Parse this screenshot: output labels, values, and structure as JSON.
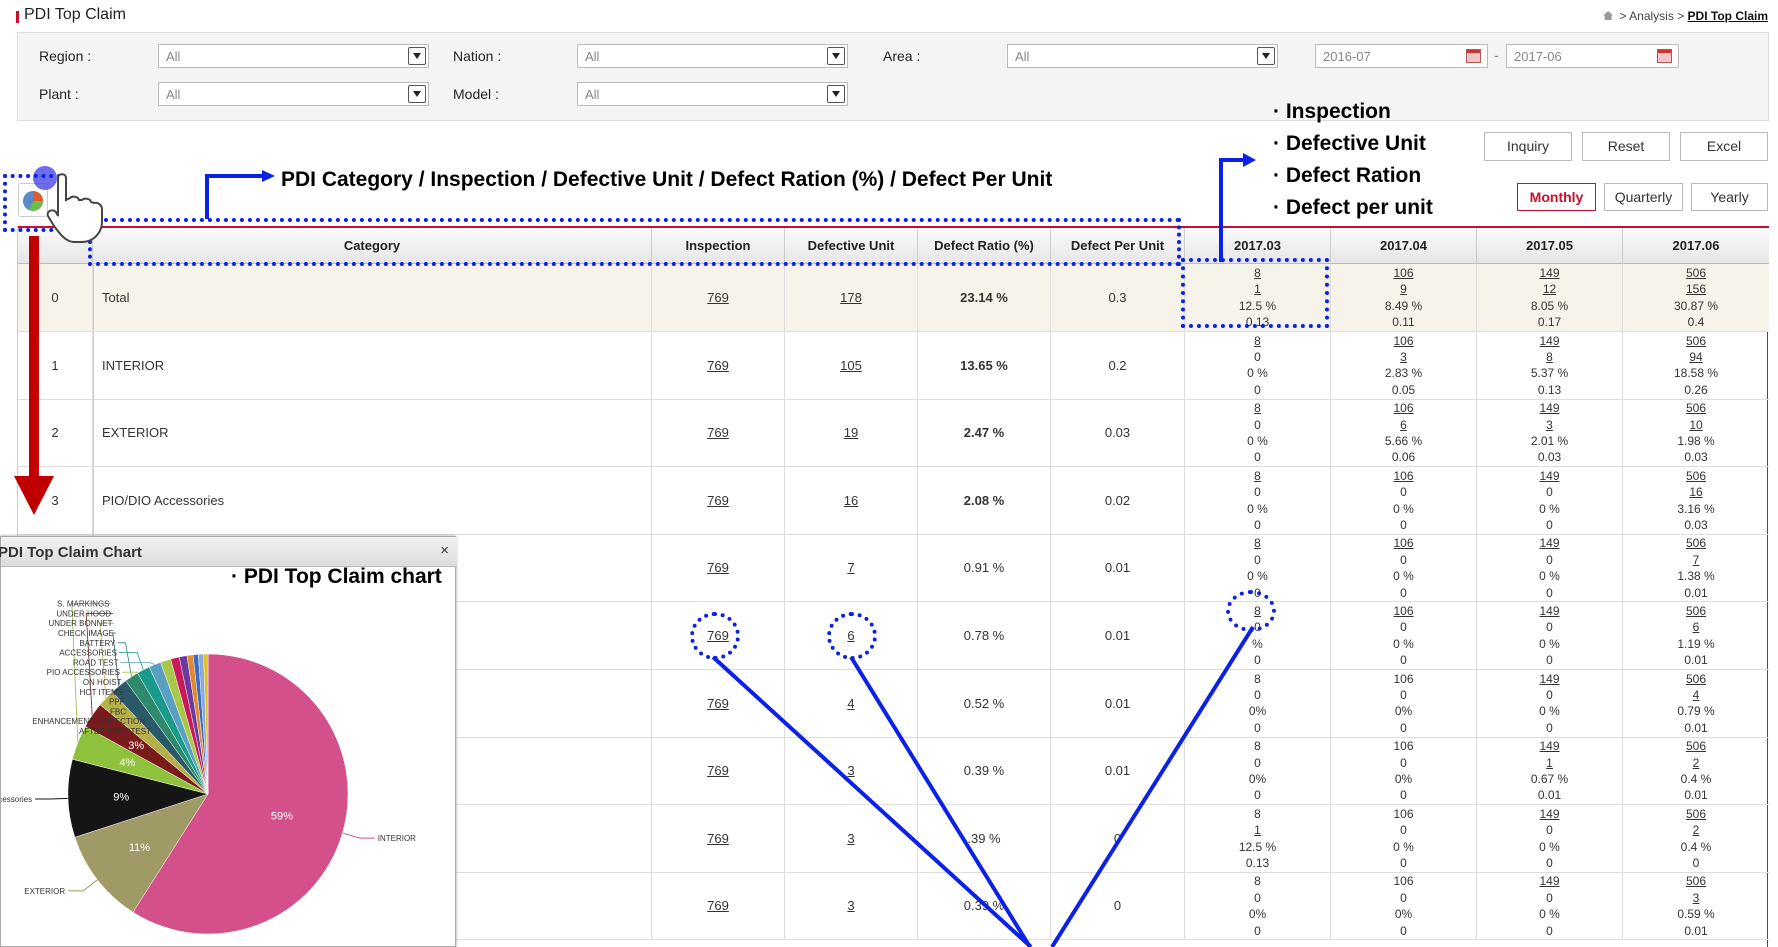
{
  "header": {
    "title": "PDI Top Claim",
    "breadcrumb": [
      "Analysis",
      "PDI Top Claim"
    ],
    "separator": ">"
  },
  "filters": {
    "region_label": "Region :",
    "region_value": "All",
    "nation_label": "Nation :",
    "nation_value": "All",
    "area_label": "Area :",
    "area_value": "All",
    "plant_label": "Plant :",
    "plant_value": "All",
    "model_label": "Model :",
    "model_value": "All",
    "date_from": "2016-07",
    "date_sep": "-",
    "date_to": "2017-06"
  },
  "buttons": {
    "inquiry": "Inquiry",
    "reset": "Reset",
    "excel": "Excel"
  },
  "period_tabs": [
    {
      "label": "Monthly",
      "active": true
    },
    {
      "label": "Quarterly",
      "active": false
    },
    {
      "label": "Yearly",
      "active": false
    }
  ],
  "table": {
    "columns": [
      "Category",
      "Inspection",
      "Defective Unit",
      "Defect Ratio (%)",
      "Defect Per Unit"
    ],
    "months": [
      "2017.03",
      "2017.04",
      "2017.05",
      "2017.06"
    ],
    "rows": [
      {
        "no": "0",
        "category": "Total",
        "inspection": "769",
        "defective": "178",
        "ratio": "23.14 %",
        "dpu": "0.3",
        "monthly": [
          [
            "8",
            "1",
            "12.5 %",
            "0.13"
          ],
          [
            "106",
            "9",
            "8.49 %",
            "0.11"
          ],
          [
            "149",
            "12",
            "8.05 %",
            "0.17"
          ],
          [
            "506",
            "156",
            "30.87 %",
            "0.4"
          ]
        ]
      },
      {
        "no": "1",
        "category": "INTERIOR",
        "inspection": "769",
        "defective": "105",
        "ratio": "13.65 %",
        "dpu": "0.2",
        "monthly": [
          [
            "8",
            "0",
            "0 %",
            "0"
          ],
          [
            "106",
            "3",
            "2.83 %",
            "0.05"
          ],
          [
            "149",
            "8",
            "5.37 %",
            "0.13"
          ],
          [
            "506",
            "94",
            "18.58 %",
            "0.26"
          ]
        ]
      },
      {
        "no": "2",
        "category": "EXTERIOR",
        "inspection": "769",
        "defective": "19",
        "ratio": "2.47 %",
        "dpu": "0.03",
        "monthly": [
          [
            "8",
            "0",
            "0 %",
            "0"
          ],
          [
            "106",
            "6",
            "5.66 %",
            "0.06"
          ],
          [
            "149",
            "3",
            "2.01 %",
            "0.03"
          ],
          [
            "506",
            "10",
            "1.98 %",
            "0.03"
          ]
        ]
      },
      {
        "no": "3",
        "category": "PIO/DIO Accessories",
        "inspection": "769",
        "defective": "16",
        "ratio": "2.08 %",
        "dpu": "0.02",
        "monthly": [
          [
            "8",
            "0",
            "0 %",
            "0"
          ],
          [
            "106",
            "0",
            "0 %",
            "0"
          ],
          [
            "149",
            "0",
            "0 %",
            "0"
          ],
          [
            "506",
            "16",
            "3.16 %",
            "0.03"
          ]
        ]
      },
      {
        "no": "",
        "category": "",
        "inspection": "769",
        "defective": "7",
        "ratio": "0.91 %",
        "dpu": "0.01",
        "monthly": [
          [
            "8",
            "0",
            "0 %",
            "0"
          ],
          [
            "106",
            "0",
            "0 %",
            "0"
          ],
          [
            "149",
            "0",
            "0 %",
            "0"
          ],
          [
            "506",
            "7",
            "1.38 %",
            "0.01"
          ]
        ]
      },
      {
        "no": "",
        "category": "",
        "inspection": "769",
        "defective": "6",
        "ratio": "0.78 %",
        "dpu": "0.01",
        "monthly": [
          [
            "8",
            "0",
            "%",
            "0"
          ],
          [
            "106",
            "0",
            "0 %",
            "0"
          ],
          [
            "149",
            "0",
            "0 %",
            "0"
          ],
          [
            "506",
            "6",
            "1.19 %",
            "0.01"
          ]
        ]
      },
      {
        "no": "",
        "category": "",
        "inspection": "769",
        "defective": "4",
        "ratio": "0.52 %",
        "dpu": "0.01",
        "monthly": [
          [
            "8",
            "0",
            "0%",
            "0"
          ],
          [
            "106",
            "0",
            "0%",
            "0"
          ],
          [
            "149",
            "0",
            "0 %",
            "0"
          ],
          [
            "506",
            "4",
            "0.79 %",
            "0.01"
          ]
        ]
      },
      {
        "no": "",
        "category": "",
        "inspection": "769",
        "defective": "3",
        "ratio": "0.39 %",
        "dpu": "0.01",
        "monthly": [
          [
            "8",
            "0",
            "0%",
            "0"
          ],
          [
            "106",
            "0",
            "0%",
            "0"
          ],
          [
            "149",
            "1",
            "0.67 %",
            "0.01"
          ],
          [
            "506",
            "2",
            "0.4 %",
            "0.01"
          ]
        ]
      },
      {
        "no": "",
        "category": "",
        "inspection": "769",
        "defective": "3",
        "ratio": ".39 %",
        "dpu": "0",
        "monthly": [
          [
            "8",
            "1",
            "12.5 %",
            "0.13"
          ],
          [
            "106",
            "0",
            "0 %",
            "0"
          ],
          [
            "149",
            "0",
            "0 %",
            "0"
          ],
          [
            "506",
            "2",
            "0.4 %",
            "0"
          ]
        ]
      },
      {
        "no": "",
        "category": "",
        "inspection": "769",
        "defective": "3",
        "ratio": "0.39 %",
        "dpu": "0",
        "monthly": [
          [
            "8",
            "0",
            "0%",
            "0"
          ],
          [
            "106",
            "0",
            "0%",
            "0"
          ],
          [
            "149",
            "0",
            "0 %",
            "0"
          ],
          [
            "506",
            "3",
            "0.59 %",
            "0.01"
          ]
        ]
      }
    ]
  },
  "annotations": {
    "columns_note": "PDI Category / Inspection  / Defective Unit / Defect Ration (%) / Defect Per Unit",
    "cell_items": [
      "· Inspection",
      "· Defective Unit",
      "· Defect Ration",
      "· Defect per unit"
    ],
    "chart_note": "· PDI Top Claim chart",
    "colors": {
      "annotation": "#0b22e6",
      "arrow_red": "#c00000"
    }
  },
  "chart_window": {
    "title": "PDI Top Claim Chart",
    "close": "×"
  },
  "chart_data": {
    "type": "pie",
    "title": "",
    "slices": [
      {
        "label": "INTERIOR",
        "value": 59,
        "pct_label": "59%",
        "color": "#d4508a"
      },
      {
        "label": "EXTERIOR",
        "value": 11,
        "pct_label": "11%",
        "color": "#a09a66"
      },
      {
        "label": "Accessories",
        "value": 9,
        "pct_label": "9%",
        "color": "#151515"
      },
      {
        "label": "S. MARKINGS",
        "value": 4,
        "pct_label": "4%",
        "color": "#8fc23c"
      },
      {
        "label": "UNDER HOOD",
        "value": 3,
        "pct_label": "3%",
        "color": "#7a1a1a"
      },
      {
        "label": "UNDER BONNET",
        "value": 2,
        "pct_label": "",
        "color": "#b5b04a"
      },
      {
        "label": "CHECK IMAGE",
        "value": 2,
        "pct_label": "",
        "color": "#2a5a6a"
      },
      {
        "label": "BATTERY",
        "value": 1.6,
        "pct_label": "",
        "color": "#2d8a6a"
      },
      {
        "label": "ACCESSORIES",
        "value": 1.5,
        "pct_label": "",
        "color": "#1a9a8a"
      },
      {
        "label": "ROAD TEST",
        "value": 1.4,
        "pct_label": "",
        "color": "#5aa0c0"
      },
      {
        "label": "PIO ACCESSORIES",
        "value": 1.2,
        "pct_label": "",
        "color": "#a8c84a"
      },
      {
        "label": "ON HOIST",
        "value": 1,
        "pct_label": "",
        "color": "#c81a5a"
      },
      {
        "label": "HOT ITEMS",
        "value": 0.9,
        "pct_label": "",
        "color": "#6a3aa0"
      },
      {
        "label": "PPF",
        "value": 0.7,
        "pct_label": "",
        "color": "#e08a2a"
      },
      {
        "label": "FBC",
        "value": 0.6,
        "pct_label": "",
        "color": "#3a6ac8"
      },
      {
        "label": "ENHANCEMENT INSPECTION",
        "value": 0.6,
        "pct_label": "",
        "color": "#8aa8d8"
      },
      {
        "label": "AFTER ROADTEST",
        "value": 0.5,
        "pct_label": "",
        "color": "#e0c020"
      }
    ]
  }
}
